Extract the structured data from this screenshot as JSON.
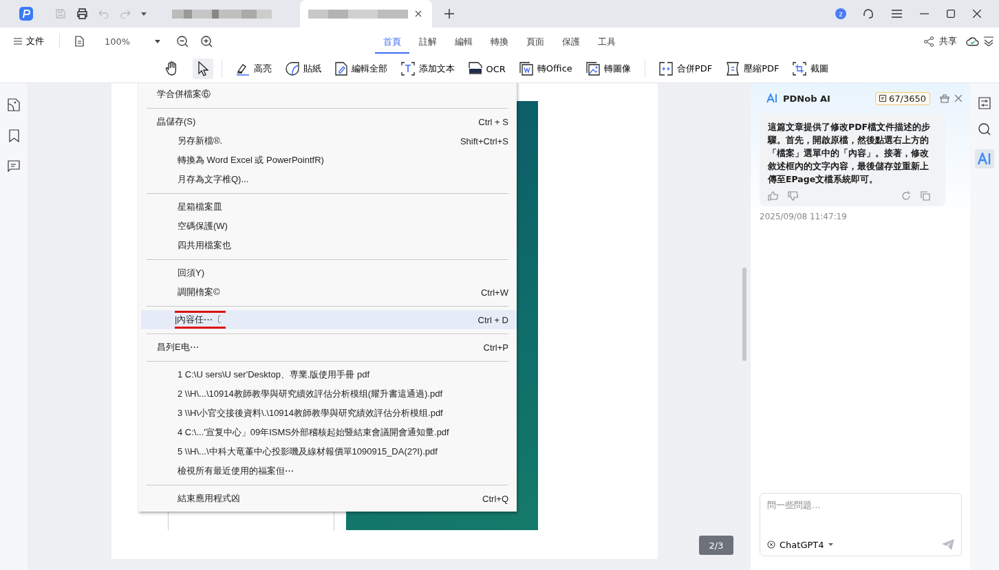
{
  "title_bar": {
    "doc_tabs": [
      {
        "selected": false
      },
      {
        "selected": true
      }
    ],
    "avatar": "z"
  },
  "menu_bar": {
    "file": "文件",
    "zoom": "100%",
    "tabs": [
      {
        "label": "首頁",
        "selected": true
      },
      {
        "label": "註解",
        "selected": false
      },
      {
        "label": "編輯",
        "selected": false
      },
      {
        "label": "轉換",
        "selected": false
      },
      {
        "label": "頁面",
        "selected": false
      },
      {
        "label": "保護",
        "selected": false
      },
      {
        "label": "工具",
        "selected": false
      }
    ],
    "share": "共享"
  },
  "toolbar": {
    "pointer_selected": true,
    "tools": [
      {
        "kind": "highlight",
        "label": "高亮"
      },
      {
        "kind": "sticker",
        "label": "貼紙"
      },
      {
        "kind": "edit",
        "label": "編輯全部"
      },
      {
        "kind": "text",
        "label": "添加文本"
      },
      {
        "kind": "ocr",
        "label": "OCR"
      },
      {
        "kind": "office",
        "label": "轉Office"
      },
      {
        "kind": "image",
        "label": "轉圖像"
      },
      {
        "kind": "separator"
      },
      {
        "kind": "merge",
        "label": "合併PDF"
      },
      {
        "kind": "compress",
        "label": "壓縮PDF"
      },
      {
        "kind": "crop",
        "label": "截圖"
      }
    ]
  },
  "document": {
    "menu": [
      {
        "kind": "top",
        "label": "学合併檔案⑥",
        "selected": false
      },
      {
        "kind": "separator"
      },
      {
        "kind": "top",
        "label": "皛儲存(S)",
        "shortcut": "Ctrl + S",
        "selected": false
      },
      {
        "kind": "sub",
        "label": "另存新檔®.",
        "shortcut": "Shift+Ctrl+S",
        "selected": false
      },
      {
        "kind": "sub",
        "label": "轉換為  Word Excel 或  PowerPointfR)",
        "selected": false
      },
      {
        "kind": "sub",
        "label": "月存為文字椎Q)...",
        "selected": false
      },
      {
        "kind": "separator"
      },
      {
        "kind": "sub",
        "label": "星箱檔案皿",
        "selected": false
      },
      {
        "kind": "sub",
        "label": "空碼保護(W)",
        "selected": false
      },
      {
        "kind": "sub",
        "label": "四共用檔案也",
        "selected": false
      },
      {
        "kind": "separator"
      },
      {
        "kind": "sub",
        "label": "回須Y)",
        "selected": false
      },
      {
        "kind": "sub",
        "label": "調開楕案©",
        "shortcut": "Ctrl+W",
        "selected": false
      },
      {
        "kind": "separator"
      },
      {
        "kind": "sub",
        "label": "|內容任⋯〔",
        "shortcut": "Ctrl + D",
        "selected": true
      },
      {
        "kind": "separator"
      },
      {
        "kind": "top",
        "label": "昌列E电⋯",
        "shortcut": "Ctrl+P",
        "selected": false
      },
      {
        "kind": "separator"
      },
      {
        "kind": "sub",
        "label": "1 C:\\U sers\\U ser'Desktop、専業.版使用手冊  pdf",
        "selected": false
      },
      {
        "kind": "sub",
        "label": "2  \\\\H\\...\\10914教師教學與研究續效評估分析模组(耀升書這通過).pdf",
        "selected": false
      },
      {
        "kind": "sub",
        "label": "3 \\\\H\\小官交接後資料\\.\\10914教師教學與研究績效評估分析模组.pdf",
        "selected": false
      },
      {
        "kind": "sub",
        "label": "4  C:\\...'宣复中心」09年ISMS外部稽核起始暨結束會議開會通知量.pdf",
        "selected": false
      },
      {
        "kind": "sub",
        "label": "5 \\\\H\\...\\中科大竜堇中心投影嘰及線材報價單1090915_DA(2?I).pdf",
        "selected": false
      },
      {
        "kind": "sub",
        "label": "檢視所有最近使用的福案但⋯",
        "selected": false
      },
      {
        "kind": "separator"
      },
      {
        "kind": "sub",
        "label": "結束應用程式凶",
        "shortcut": "Ctrl+Q",
        "selected": false
      }
    ],
    "page_counter": "2/3"
  },
  "ai_panel": {
    "title": "PDNob AI",
    "quota": "67/3650",
    "message": "這篇文章提供了修改PDF檔文件描述的步驟。首先，開啟原檔，然後點選右上方的「檔案」選單中的「內容」。接著，修改敘述框內的文字內容，最後儲存並重新上傳至EPage文檔系統即可。",
    "timestamp": "2025/09/08 11:47:19",
    "input": {
      "placeholder": "問一些問題..."
    },
    "model": "ChatGPT4"
  }
}
